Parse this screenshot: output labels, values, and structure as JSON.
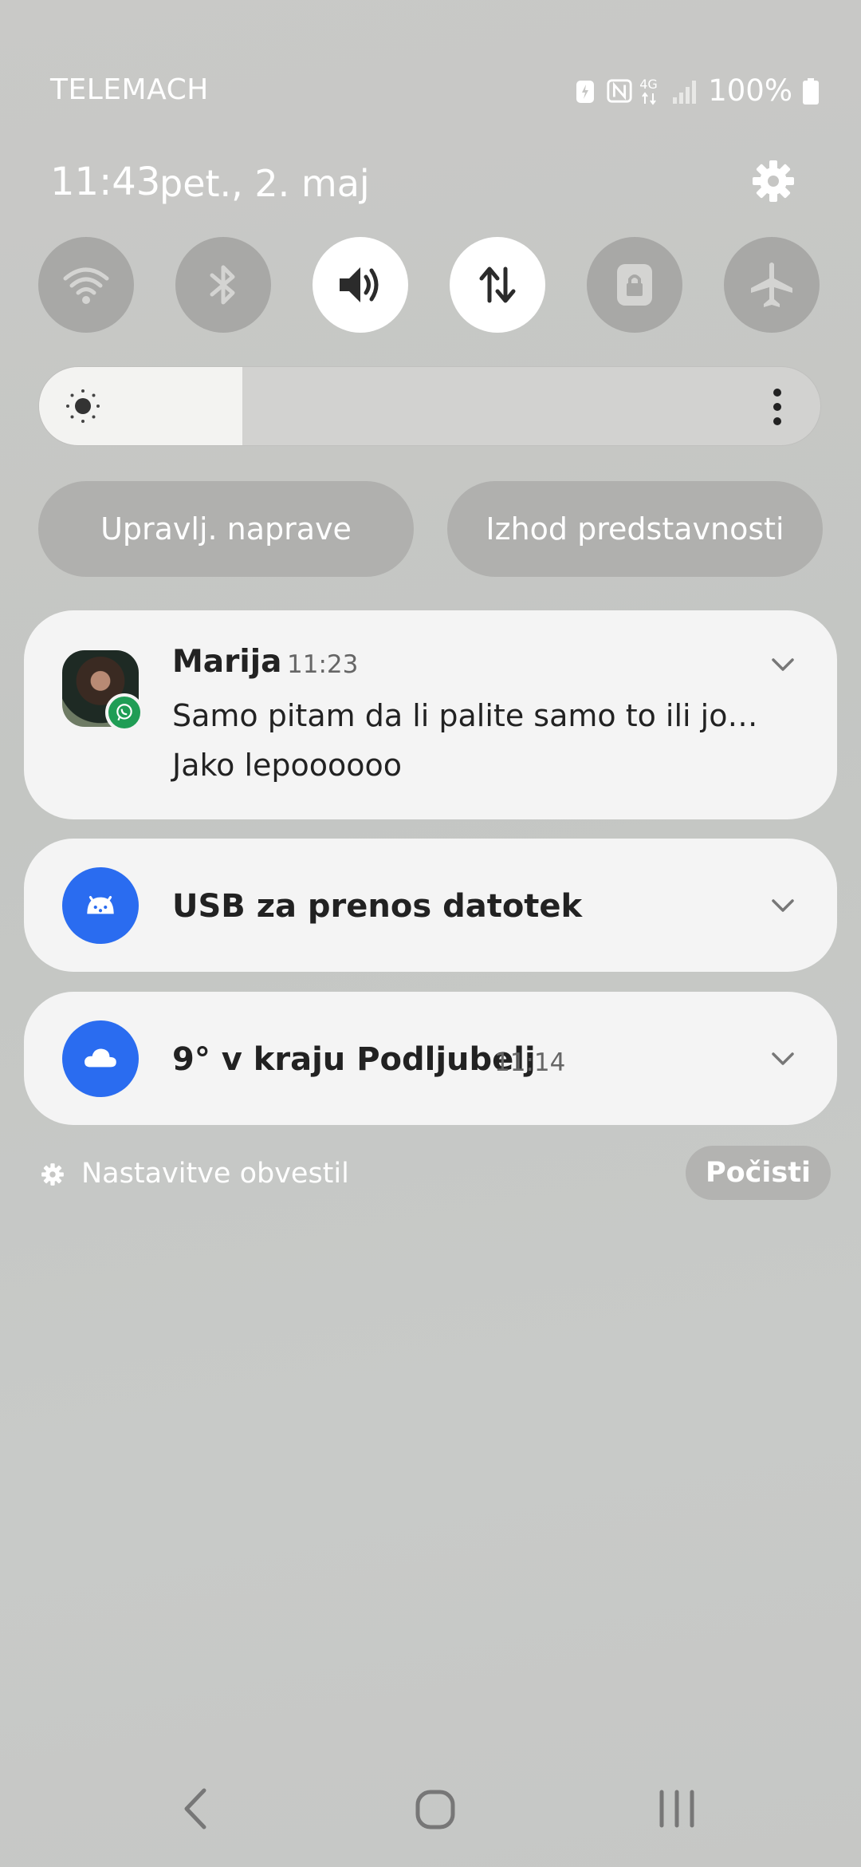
{
  "status_bar": {
    "carrier": "TELEMACH",
    "network_type": "4G",
    "battery_percent": "100%",
    "icons": [
      "battery-saver-icon",
      "nfc-icon",
      "4g-icon",
      "signal-icon",
      "battery-icon"
    ]
  },
  "header": {
    "time": "11:43",
    "date": "pet., 2. maj",
    "settings_icon": "gear-icon"
  },
  "quick_toggles": [
    {
      "name": "wifi",
      "icon": "wifi-icon",
      "active": false
    },
    {
      "name": "bluetooth",
      "icon": "bluetooth-icon",
      "active": false
    },
    {
      "name": "sound",
      "icon": "volume-icon",
      "active": true
    },
    {
      "name": "mobile-data",
      "icon": "data-arrows-icon",
      "active": true
    },
    {
      "name": "rotation-lock",
      "icon": "lock-icon",
      "active": false
    },
    {
      "name": "airplane-mode",
      "icon": "airplane-icon",
      "active": false
    }
  ],
  "brightness": {
    "level": 0.26,
    "icon": "sun-icon",
    "more_icon": "more-vertical-icon"
  },
  "pills": {
    "device_control": "Upravlj. naprave",
    "media_output": "Izhod predstavnosti"
  },
  "notifications": {
    "whatsapp": {
      "sender": "Marija",
      "time": "11:23",
      "line1": "Samo pitam da li palite samo to ili jo…",
      "line2": "Jako lepoooooo",
      "app_icon": "whatsapp-icon"
    },
    "usb": {
      "title": "USB za prenos datotek",
      "icon": "android-system-icon"
    },
    "weather": {
      "title": "9° v kraju Podljubelj",
      "time": "11:14",
      "icon": "cloud-icon"
    }
  },
  "footer": {
    "notification_settings": "Nastavitve obvestil",
    "clear": "Počisti"
  },
  "colors": {
    "accent_blue": "#2a6cf0",
    "whatsapp_green": "#1f9d55",
    "card_bg": "#f4f4f4"
  }
}
